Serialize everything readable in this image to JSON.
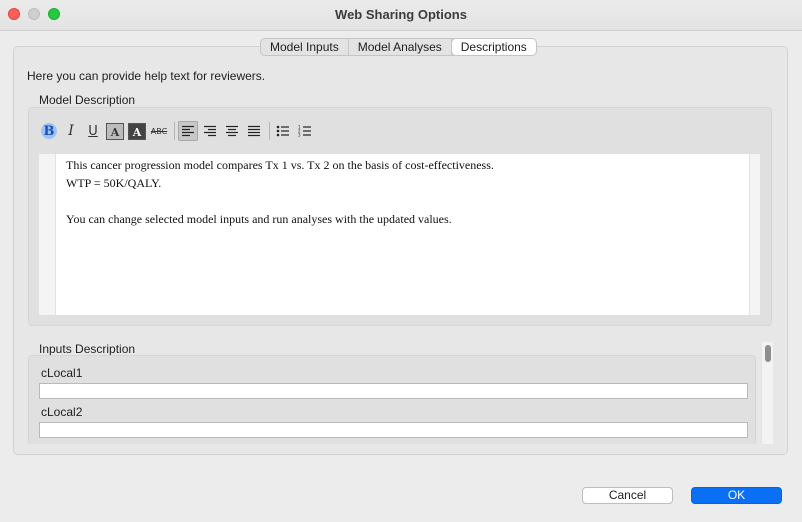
{
  "window": {
    "title": "Web Sharing Options"
  },
  "tabs": [
    {
      "label": "Model Inputs"
    },
    {
      "label": "Model Analyses"
    },
    {
      "label": "Descriptions",
      "active": true
    }
  ],
  "help_text": "Here you can provide help text for reviewers.",
  "model_description": {
    "label": "Model Description",
    "lines": [
      "This cancer progression model compares Tx 1 vs. Tx 2 on the basis of cost-effectiveness.",
      "WTP = 50K/QALY.",
      "",
      "You can change selected model inputs and run analyses with the updated values."
    ]
  },
  "toolbar": {
    "items": [
      {
        "name": "bold-icon",
        "glyph": "B"
      },
      {
        "name": "italic-icon",
        "glyph": "I"
      },
      {
        "name": "underline-icon",
        "glyph": "U"
      },
      {
        "name": "font-color-icon",
        "glyph": "A"
      },
      {
        "name": "highlight-color-icon",
        "glyph": "A"
      },
      {
        "name": "strikethrough-icon",
        "glyph": "ABC"
      },
      {
        "name": "align-left-icon"
      },
      {
        "name": "align-right-icon"
      },
      {
        "name": "align-center-icon"
      },
      {
        "name": "align-justify-icon"
      },
      {
        "name": "bullet-list-icon"
      },
      {
        "name": "numbered-list-icon"
      }
    ]
  },
  "inputs_description": {
    "label": "Inputs Description",
    "fields": [
      {
        "label": "cLocal1",
        "value": ""
      },
      {
        "label": "cLocal2",
        "value": ""
      }
    ]
  },
  "buttons": {
    "cancel": "Cancel",
    "ok": "OK"
  },
  "colors": {
    "accent": "#0a6ff5",
    "close": "#fe5f57",
    "maximize": "#28c840"
  }
}
